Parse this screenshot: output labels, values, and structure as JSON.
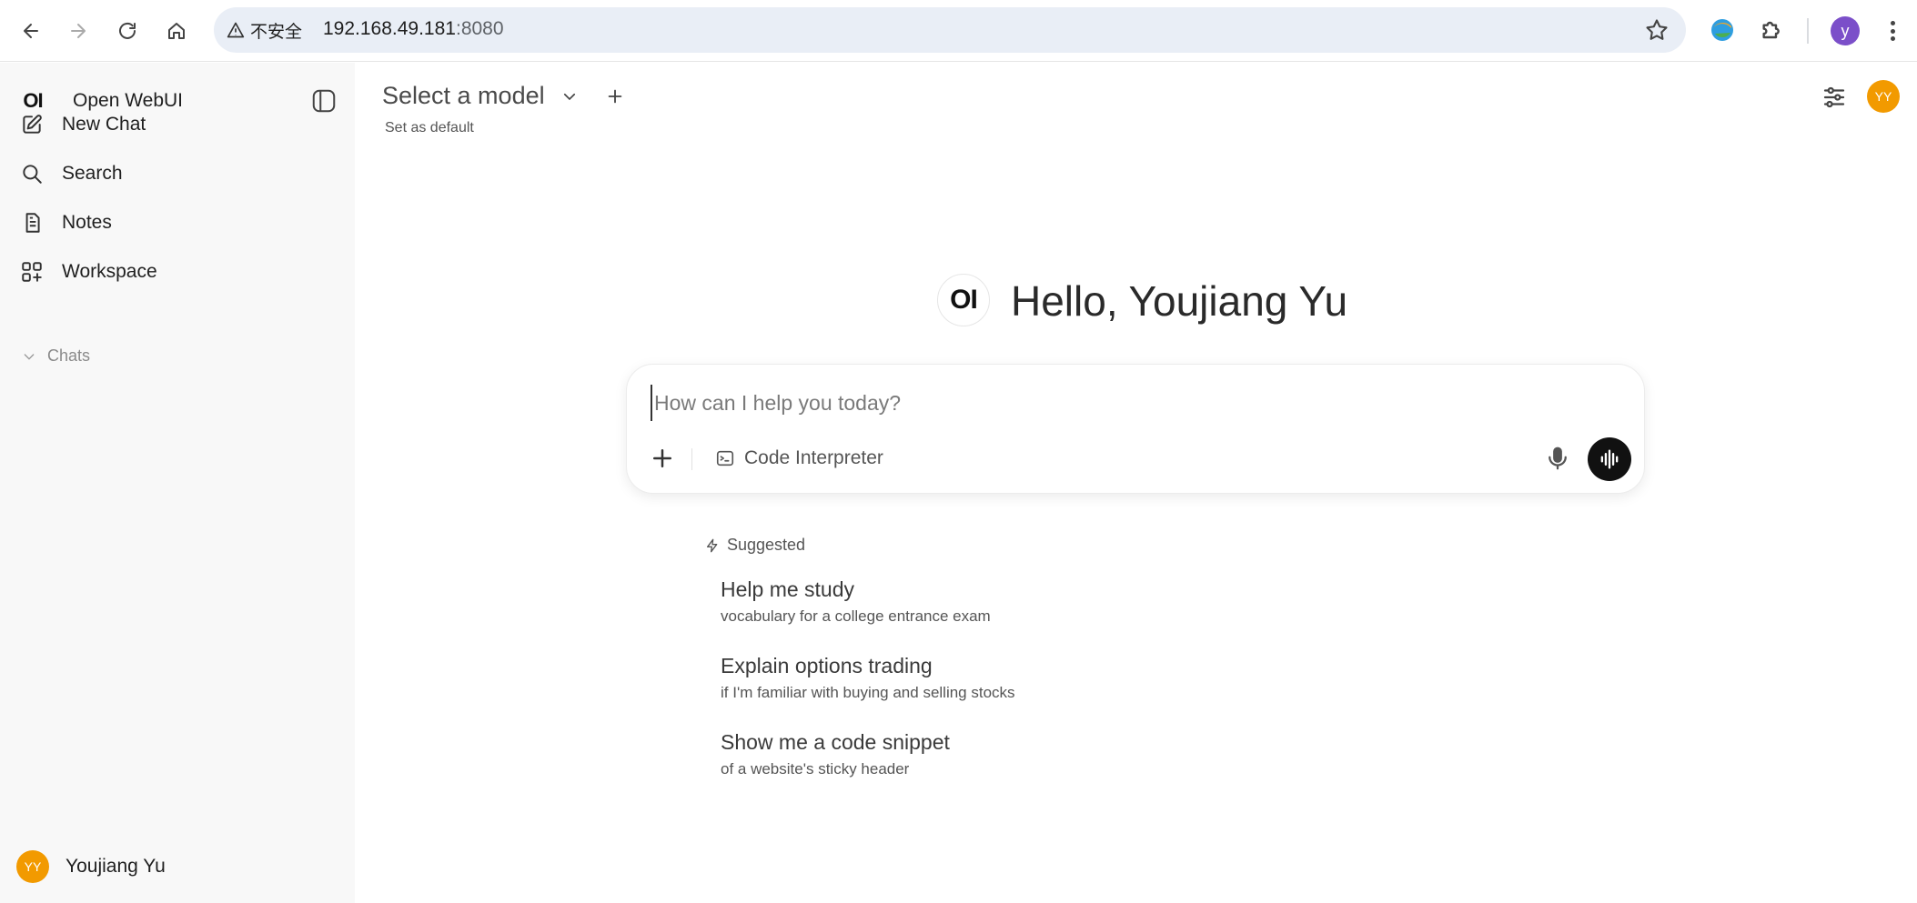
{
  "browser": {
    "insecure_label": "不安全",
    "url_host": "192.168.49.181",
    "url_port": ":8080",
    "profile_initial": "y"
  },
  "sidebar": {
    "brand_logo": "OI",
    "brand_name": "Open WebUI",
    "items": [
      {
        "label": "New Chat",
        "icon": "pencil-square-icon"
      },
      {
        "label": "Search",
        "icon": "search-icon"
      },
      {
        "label": "Notes",
        "icon": "notes-icon"
      },
      {
        "label": "Workspace",
        "icon": "workspace-icon"
      }
    ],
    "chats_label": "Chats",
    "user": {
      "initials": "YY",
      "name": "Youjiang Yu"
    }
  },
  "header": {
    "model_title": "Select a model",
    "set_default": "Set as default",
    "avatar_initials": "YY"
  },
  "greeting": {
    "logo": "OI",
    "text": "Hello, Youjiang Yu"
  },
  "composer": {
    "placeholder": "How can I help you today?",
    "code_interpreter_label": "Code Interpreter"
  },
  "suggested": {
    "heading": "Suggested",
    "items": [
      {
        "title": "Help me study",
        "subtitle": "vocabulary for a college entrance exam"
      },
      {
        "title": "Explain options trading",
        "subtitle": "if I'm familiar with buying and selling stocks"
      },
      {
        "title": "Show me a code snippet",
        "subtitle": "of a website's sticky header"
      }
    ]
  },
  "colors": {
    "avatar": "#f29a00",
    "profile": "#7b4fc9",
    "voice_button": "#111111",
    "sidebar_bg": "#f8f8f8",
    "omnibox_bg": "#e9eef6"
  }
}
